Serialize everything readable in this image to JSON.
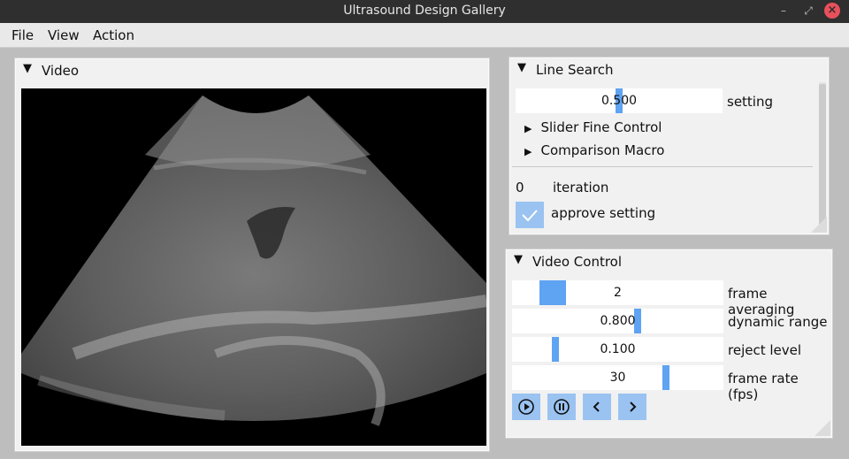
{
  "window": {
    "title": "Ultrasound Design Gallery"
  },
  "menu": {
    "file": "File",
    "view": "View",
    "action": "Action"
  },
  "video_panel": {
    "title": "Video"
  },
  "line_search": {
    "title": "Line Search",
    "setting": {
      "value": "0.500",
      "label": "setting",
      "fill": 0.5
    },
    "slider_fine_control": "Slider Fine Control",
    "comparison_macro": "Comparison Macro",
    "iteration": {
      "value": "0",
      "label": "iteration"
    },
    "approve": {
      "label": "approve setting",
      "checked": true
    }
  },
  "video_control": {
    "title": "Video Control",
    "frame_averaging": {
      "value": "2",
      "label": "frame averaging"
    },
    "dynamic_range": {
      "value": "0.800",
      "label": "dynamic range"
    },
    "reject_level": {
      "value": "0.100",
      "label": "reject level"
    },
    "frame_rate": {
      "value": "30",
      "label": "frame rate (fps)"
    }
  },
  "colors": {
    "accent": "#5fa3f3",
    "button": "#9ac3f1",
    "titlebar": "#2f2f2f",
    "close": "#e8505b"
  }
}
